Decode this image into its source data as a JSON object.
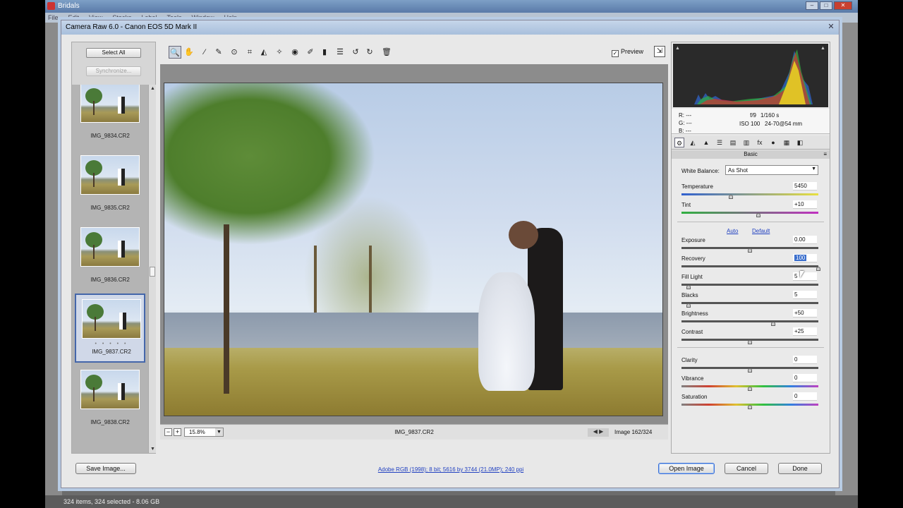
{
  "bridge": {
    "title": "Bridals",
    "menu": [
      "File",
      "Edit",
      "View",
      "Stacks",
      "Label",
      "Tools",
      "Window",
      "Help"
    ],
    "status": "324 items, 324 selected - 8.06 GB"
  },
  "dialog": {
    "title": "Camera Raw 6.0  -  Canon EOS 5D Mark II",
    "close": "✕"
  },
  "filmstrip": {
    "select_all": "Select All",
    "synchronize": "Synchronize...",
    "items": [
      {
        "name": "IMG_9834.CR2"
      },
      {
        "name": "IMG_9835.CR2"
      },
      {
        "name": "IMG_9836.CR2"
      },
      {
        "name": "IMG_9837.CR2",
        "stars": "• • • • •"
      },
      {
        "name": "IMG_9838.CR2"
      }
    ]
  },
  "toolbar": {
    "tools": [
      {
        "name": "zoom-icon",
        "glyph": "🔍"
      },
      {
        "name": "hand-icon",
        "glyph": "✋"
      },
      {
        "name": "white-balance-icon",
        "glyph": "⁄"
      },
      {
        "name": "color-sampler-icon",
        "glyph": "✎"
      },
      {
        "name": "targeted-adjust-icon",
        "glyph": "⊙"
      },
      {
        "name": "crop-icon",
        "glyph": "⌗"
      },
      {
        "name": "straighten-icon",
        "glyph": "◭"
      },
      {
        "name": "spot-removal-icon",
        "glyph": "✧"
      },
      {
        "name": "red-eye-icon",
        "glyph": "◉"
      },
      {
        "name": "adjustment-brush-icon",
        "glyph": "✐"
      },
      {
        "name": "graduated-filter-icon",
        "glyph": "▮"
      },
      {
        "name": "preferences-icon",
        "glyph": "☰"
      },
      {
        "name": "rotate-left-icon",
        "glyph": "↺"
      },
      {
        "name": "rotate-right-icon",
        "glyph": "↻"
      },
      {
        "name": "trash-icon",
        "glyph": "🗑"
      }
    ],
    "preview_label": "Preview",
    "preview_checked": "✓",
    "fullscreen": "⇲"
  },
  "canvas": {
    "zoom": "15.8%",
    "filename": "IMG_9837.CR2",
    "nav": "◀ ▶",
    "image_count": "Image 162/324",
    "zoom_out": "−",
    "zoom_in": "+"
  },
  "info": {
    "r": "R:  ---",
    "g": "G:  ---",
    "b": "B:  ---",
    "aperture": "f/9",
    "shutter": "1/160 s",
    "iso": "ISO 100",
    "lens": "24-70@54 mm"
  },
  "panel": {
    "title": "Basic",
    "menu": "≡",
    "tabs": [
      "⚙",
      "◭",
      "▲",
      "☰",
      "▤",
      "▥",
      "fx",
      "●",
      "▦",
      "◧"
    ],
    "white_balance_label": "White Balance:",
    "white_balance_value": "As Shot",
    "auto": "Auto",
    "default": "Default",
    "sliders": [
      {
        "label": "Temperature",
        "value": "5450",
        "pos": 0.36
      },
      {
        "label": "Tint",
        "value": "+10",
        "pos": 0.56
      },
      {
        "label": "Exposure",
        "value": "0.00",
        "pos": 0.5
      },
      {
        "label": "Recovery",
        "value": "100",
        "pos": 1.0
      },
      {
        "label": "Fill Light",
        "value": "5",
        "pos": 0.05
      },
      {
        "label": "Blacks",
        "value": "5",
        "pos": 0.05
      },
      {
        "label": "Brightness",
        "value": "+50",
        "pos": 0.67
      },
      {
        "label": "Contrast",
        "value": "+25",
        "pos": 0.5
      },
      {
        "label": "Clarity",
        "value": "0",
        "pos": 0.5
      },
      {
        "label": "Vibrance",
        "value": "0",
        "pos": 0.5
      },
      {
        "label": "Saturation",
        "value": "0",
        "pos": 0.5
      }
    ]
  },
  "buttons": {
    "save": "Save Image...",
    "workflow": "Adobe RGB (1998); 8 bit; 5616 by 3744 (21.0MP); 240 ppi",
    "open": "Open Image",
    "cancel": "Cancel",
    "done": "Done"
  },
  "colors": {
    "accent": "#3a6ed8",
    "title_bar": "#a8bfdc"
  }
}
